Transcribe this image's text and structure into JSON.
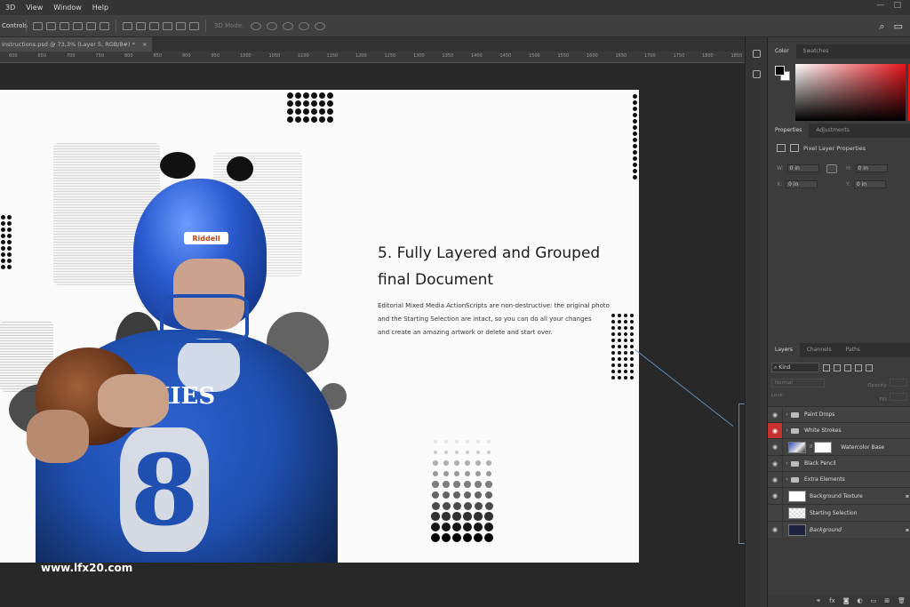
{
  "menu": {
    "items": [
      "3D",
      "View",
      "Window",
      "Help"
    ]
  },
  "options_bar": {
    "label": "Controls",
    "mode_label": "3D Mode:"
  },
  "document": {
    "tab_title": "Instructions.psd @ 73,3% (Layer 5, RGB/8#) *",
    "close_glyph": "×"
  },
  "ruler": {
    "ticks": [
      "600",
      "650",
      "700",
      "750",
      "800",
      "850",
      "900",
      "950",
      "1000",
      "1050",
      "1100",
      "1150",
      "1200",
      "1250",
      "1300",
      "1350",
      "1400",
      "1450",
      "1500",
      "1550",
      "1600",
      "1650",
      "1700",
      "1750",
      "1800",
      "1850"
    ]
  },
  "canvas": {
    "headline_line1": "5. Fully Layered and Grouped",
    "headline_line2": "final Document",
    "body_line1": "Editorial Mixed Media ActionScripts are non-destructive: the original photo",
    "body_line2": "and the Starting Selection are intact, so you can do all your changes",
    "body_line3": "and create an amazing artwork or delete and start over.",
    "watermark": "www.lfx20.com",
    "jersey_text": "SKIES",
    "jersey_number": "8",
    "helmet_brand": "Riddell"
  },
  "color_panel": {
    "tabs": [
      "Color",
      "Swatches"
    ],
    "hue_color": "#e5151c"
  },
  "properties_panel": {
    "tabs": [
      "Properties",
      "Adjustments"
    ],
    "title": "Pixel Layer Properties",
    "w_label": "W:",
    "w_value": "0 in",
    "h_label": "H:",
    "h_value": "0 in",
    "x_label": "X:",
    "x_value": "0 in",
    "y_label": "Y:",
    "y_value": "0 in",
    "link_glyph": "GO"
  },
  "layers_panel": {
    "tabs": [
      "Layers",
      "Channels",
      "Paths"
    ],
    "kind_label": "Kind",
    "blend_mode": "Normal",
    "opacity_label": "Opacity:",
    "lock_label": "Lock:",
    "fill_label": "Fill:",
    "layers": [
      {
        "name": "Paint Drops",
        "type": "group"
      },
      {
        "name": "White Strokes",
        "type": "group",
        "eye_highlight": true
      },
      {
        "name": "Watercolor Base",
        "type": "pixel"
      },
      {
        "name": "Black Pencil",
        "type": "group"
      },
      {
        "name": "Extra Elements",
        "type": "group"
      },
      {
        "name": "Background Texture",
        "type": "pixel"
      },
      {
        "name": "Starting Selection",
        "type": "pixel"
      },
      {
        "name": "Background",
        "type": "pixel"
      }
    ],
    "footer_glyphs": [
      "fx"
    ]
  },
  "accent_colors": {
    "selection_line": "#5d8ebf",
    "eye_active": "#c8322e",
    "jersey_blue": "#1f4fb0"
  }
}
